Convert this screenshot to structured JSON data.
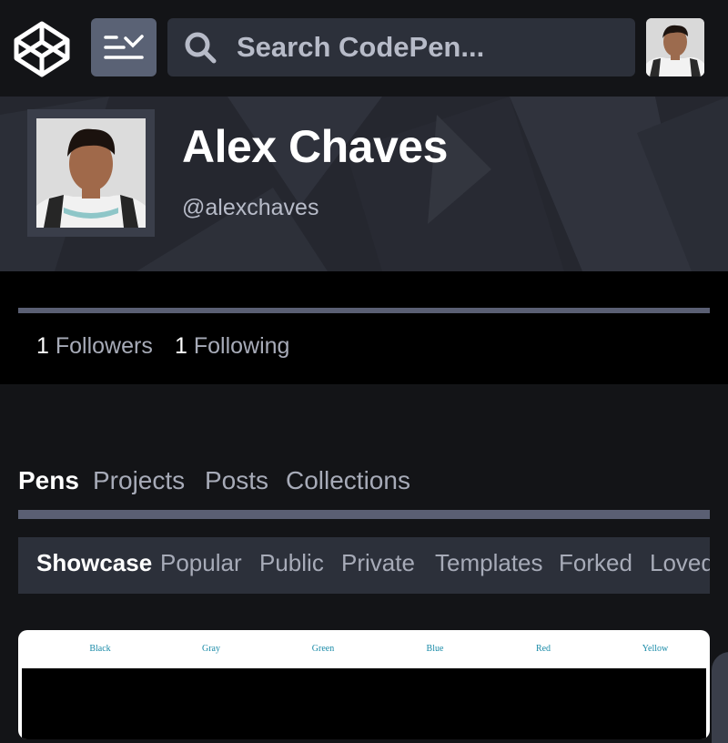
{
  "search": {
    "placeholder": "Search CodePen..."
  },
  "profile": {
    "name": "Alex Chaves",
    "handle": "@alexchaves"
  },
  "stats": {
    "followers": {
      "count": "1",
      "label": "Followers"
    },
    "following": {
      "count": "1",
      "label": "Following"
    }
  },
  "tabs": [
    {
      "label": "Pens",
      "active": true
    },
    {
      "label": "Projects"
    },
    {
      "label": "Posts"
    },
    {
      "label": "Collections"
    }
  ],
  "subtabs": [
    {
      "label": "Showcase",
      "active": true
    },
    {
      "label": "Popular"
    },
    {
      "label": "Public"
    },
    {
      "label": "Private"
    },
    {
      "label": "Templates"
    },
    {
      "label": "Forked"
    },
    {
      "label": "Loved"
    }
  ],
  "pen_card": {
    "color_labels": [
      "Black",
      "Gray",
      "Green",
      "Blue",
      "Red",
      "Yellow"
    ]
  },
  "icons": {
    "logo": "codepen-logo-icon",
    "menu": "menu-chevron-icon",
    "search": "search-icon"
  },
  "colors": {
    "topbar_bg": "#131417",
    "menu_button_bg": "#5a6275",
    "search_bg": "#2c303a",
    "header_bg": "#25272f",
    "accent_bar": "#5a5f73",
    "muted_text": "#a7abb8",
    "card_label_color": "#1a8ba8"
  }
}
